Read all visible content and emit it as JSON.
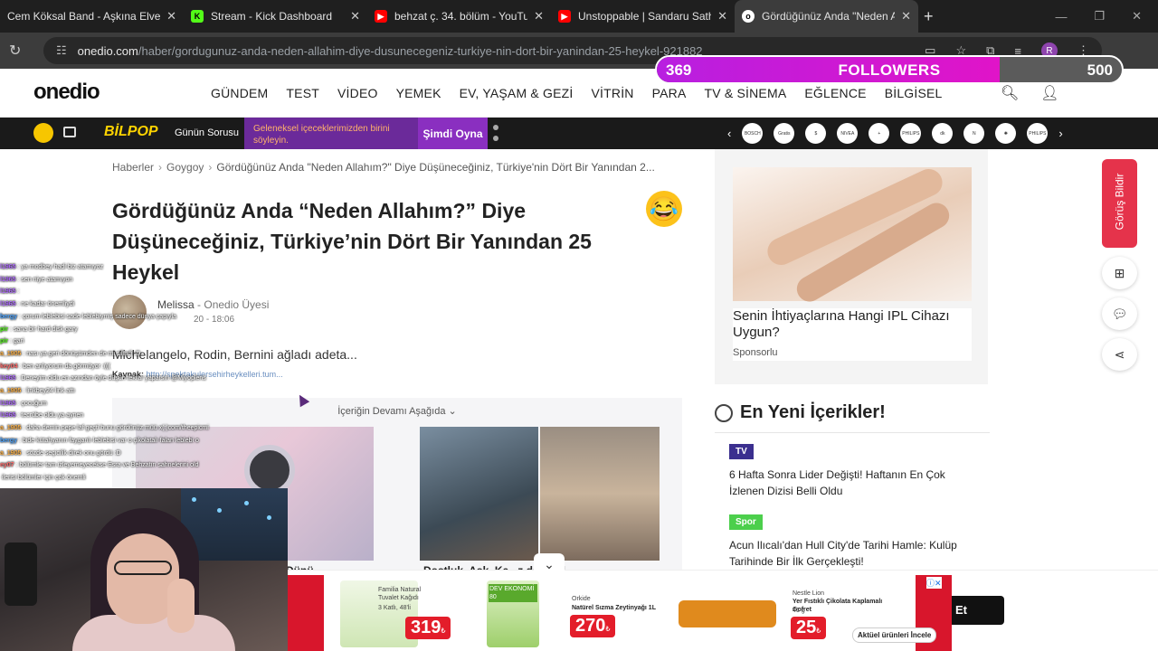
{
  "browser": {
    "tabs": [
      {
        "title": "Cem Köksal Band - Aşkına Elve",
        "icon": "music-icon"
      },
      {
        "title": "Stream - Kick Dashboard",
        "icon": "kick-icon"
      },
      {
        "title": "behzat ç. 34. bölüm - YouTube",
        "icon": "youtube-icon"
      },
      {
        "title": "Unstoppable | Sandaru Sathsar",
        "icon": "youtube-icon"
      },
      {
        "title": "Gördüğünüz Anda \"Neden Allal",
        "icon": "onedio-icon"
      }
    ],
    "url_host": "onedio.com",
    "url_path": "/haber/gordugunuz-anda-neden-allahim-diye-dusunecegeniz-turkiye-nin-dort-bir-yanindan-25-heykel-921882",
    "profile_initial": "R"
  },
  "overlay": {
    "followers_current": "369",
    "followers_label": "FOLLOWERS",
    "followers_goal": "500",
    "followers_fraction": 0.738
  },
  "site": {
    "logo": "onedio",
    "menu": [
      "GÜNDEM",
      "TEST",
      "VİDEO",
      "YEMEK",
      "EV, YAŞAM & GEZİ",
      "VİTRİN",
      "PARA",
      "TV & SİNEMA",
      "EĞLENCE",
      "BİLGİSEL"
    ]
  },
  "promo": {
    "bilpop": "BİLPOP",
    "gunun_sorusu": "Günün Sorusu",
    "question": "Geleneksel içeceklerimizden birini söyleyin.",
    "play": "Şimdi Oyna",
    "brands": [
      "BOSCH",
      "Gratis",
      "$",
      "NIVEA",
      "+",
      "PHILIPS",
      "dk",
      "N",
      "✺",
      "PHILIPS"
    ]
  },
  "article": {
    "breadcrumbs": [
      "Haberler",
      "Goygoy",
      "Gördüğünüz Anda \"Neden Allahım?\" Diye Düşüneceğiniz, Türkiye'nin Dört Bir Yanından 2..."
    ],
    "title": "Gördüğünüz Anda “Neden Allahım?” Diye Düşüneceğiniz, Türkiye’nin Dört Bir Yanından 25 Heykel",
    "emoji": "😂",
    "author": "Melissa",
    "author_role": "- Onedio Üyesi",
    "date": "20 - 18:06",
    "lead": "Michelangelo, Rodin, Bernini ağladı adeta...",
    "source_label": "Kaynak:",
    "source_url": "http://spektakulersehirheykelleri.tum...",
    "more_label": "İçeriğin Devamı Aşağıda",
    "card1_caption": "Dünü",
    "card2_caption": "Dostluk, Aşk, Ka...z da Popl"
  },
  "sidebar": {
    "ad_title": "Senin İhtiyaçlarına Hangi IPL Cihazı Uygun?",
    "ad_sponsor": "Sponsorlu",
    "new_heading": "En Yeni İçerikler!",
    "items": [
      {
        "badge": "TV",
        "title": "6 Hafta Sonra Lider Değişti! Haftanın En Çok İzlenen Dizisi Belli Oldu"
      },
      {
        "badge": "Spor",
        "title": "Acun Ilıcalı'dan Hull City'de Tarihi Hamle: Kulüp Tarihinde Bir İlk Gerçekleşti!"
      }
    ],
    "feedback": "Görüş Bildir"
  },
  "chat": [
    {
      "user": "l1965",
      "msg": ": ya modbey hadi biz atamıyoz",
      "color": "#b06cff"
    },
    {
      "user": "l1965",
      "msg": ": sen niye atamıyon",
      "color": "#b06cff"
    },
    {
      "user": "l1965",
      "msg": ": ",
      "color": "#b06cff"
    },
    {
      "user": "l1965",
      "msg": ": ne kadar önemliydi",
      "color": "#b06cff"
    },
    {
      "user": "bergy",
      "msg": ": çorum leblebisi sade leblebiymiş sadece dünya çapıyla",
      "color": "#4aa3ff"
    },
    {
      "user": "pir",
      "msg": ": sana bir hard disk gary",
      "color": "#53fc18"
    },
    {
      "user": "pir",
      "msg": ": gari",
      "color": "#53fc18"
    },
    {
      "user": "a_1905",
      "msg": ": nası ya geri dönüşümden de mi silindi :D",
      "color": "#ffb347"
    },
    {
      "user": "key04",
      "msg": ": ben anlıyorum da görmüyor :(((",
      "color": "#ff6b6b"
    },
    {
      "user": "l1965",
      "msg": ": Deneyim oldu en azından öyle düşün tekrar yaparsın @Miyoplens",
      "color": "#b06cff"
    },
    {
      "user": "a_1905",
      "msg": ": linkbey24 link attı",
      "color": "#ffb347"
    },
    {
      "user": "l1965",
      "msg": ": çocuğum",
      "color": "#b06cff"
    },
    {
      "user": "l1965",
      "msg": ": tecrübe oldu ya aynen",
      "color": "#b06cff"
    },
    {
      "user": "a_1905",
      "msg": ": daha demin pepe laf geçti bunu gördünüz müü x(:)com/theepicmi",
      "color": "#ffb347"
    },
    {
      "user": "bergy",
      "msg": ": bide kütahyanın fayganlı leblebisi var o çikolatalı falan leblebi o",
      "color": "#4aa3ff"
    },
    {
      "user": "a_1905",
      "msg": ": sözde seçicilik direk onu gördü :D",
      "color": "#ffb347"
    },
    {
      "user": "ey07",
      "msg": ": bölümler tam izleyemeyecekse Esra ve Behzatın sahnelerini old",
      "color": "#ff6b6b"
    },
    {
      "user": "",
      "msg": "ilerisi bölümler için çok önemli",
      "color": "#b06cff"
    }
  ],
  "bottom_ad": {
    "p1_brand": "Familia Natural Tuvalet Kağıdı",
    "p1_detail": "3 Katlı, 48'li",
    "p1_price": "319",
    "p2_badge": "DEV EKONOMİ 80",
    "p3_brand": "Orkide",
    "p3_detail": "Natürel Sızma Zeytinyağı 1L",
    "p3_price": "270",
    "p4_brand": "Nestle Lion",
    "p4_detail": "Yer Fıstıklı Çikolata Kaplamalı Gofret",
    "p4_weight": "41 g",
    "p4_price": "25",
    "price_suffix": "₺",
    "cta": "Aktüel ürünleri İncele"
  },
  "et_button": "Et"
}
